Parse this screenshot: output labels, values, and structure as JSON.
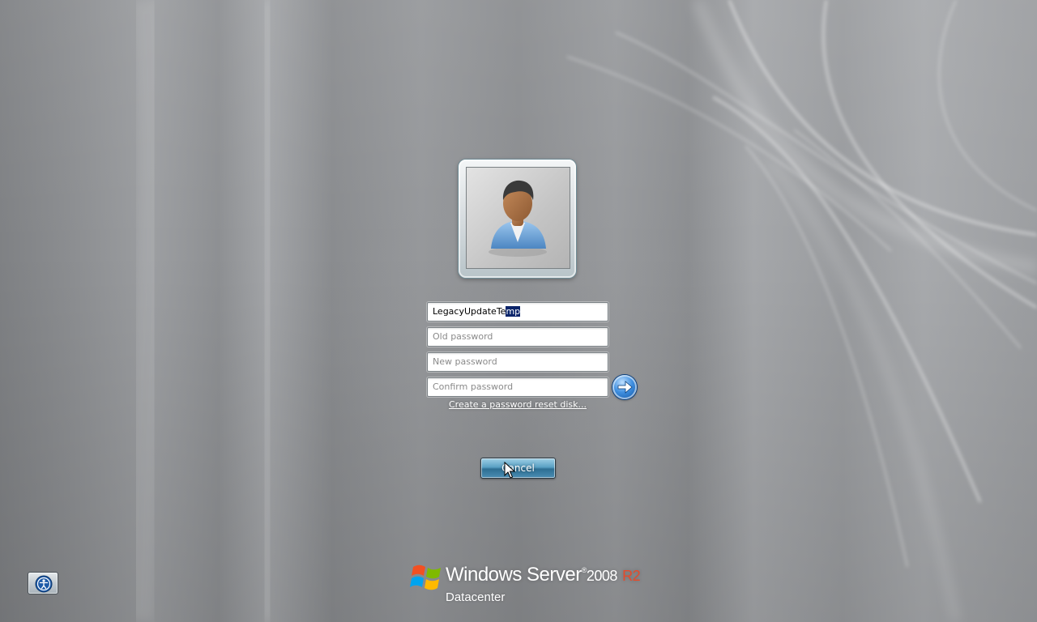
{
  "logon": {
    "username_value_unselected": "LegacyUpdateTe",
    "username_value_selected": "mp",
    "old_password_placeholder": "Old password",
    "new_password_placeholder": "New password",
    "confirm_password_placeholder": "Confirm password",
    "reset_disk_link": "Create a password reset disk...",
    "cancel_label": "Cancel",
    "submit_icon": "arrow-right-icon"
  },
  "user_tile": {
    "icon": "user-avatar-icon"
  },
  "ease_of_access": {
    "icon": "ease-of-access-icon"
  },
  "branding": {
    "product_name": "Windows Server",
    "trademark": "®",
    "version": "2008",
    "release": "R2",
    "edition": "Datacenter",
    "release_color": "#e64b2b"
  }
}
